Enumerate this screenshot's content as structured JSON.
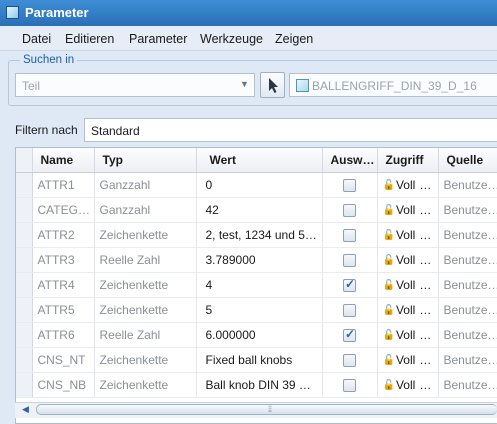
{
  "window": {
    "title": "Parameter",
    "icon": "window-icon"
  },
  "menu": [
    "Datei",
    "Editieren",
    "Parameter",
    "Werkzeuge",
    "Zeigen"
  ],
  "search": {
    "legend": "Suchen in",
    "scope_value": "Teil",
    "pick_icon": "cursor-arrow-icon",
    "object_value": "BALLENGRIFF_DIN_39_D_16",
    "object_icon": "part-icon"
  },
  "filter": {
    "label": "Filtern nach",
    "value": "Standard"
  },
  "table": {
    "columns": [
      "Name",
      "Typ",
      "Wert",
      "Ausw…",
      "Zugriff",
      "Quelle"
    ],
    "rows": [
      {
        "name": "ATTR1",
        "typ": "Ganzzahl",
        "wert": "0",
        "checked": false,
        "zugriff": "Voll",
        "quelle": "Benutze…"
      },
      {
        "name": "CATEG…",
        "typ": "Ganzzahl",
        "wert": "42",
        "checked": false,
        "zugriff": "Voll",
        "quelle": "Benutze…"
      },
      {
        "name": "ATTR2",
        "typ": "Zeichenkette",
        "wert": "2, test, 1234 und 5…",
        "checked": false,
        "zugriff": "Voll",
        "quelle": "Benutze…"
      },
      {
        "name": "ATTR3",
        "typ": "Reelle Zahl",
        "wert": "3.789000",
        "checked": false,
        "zugriff": "Voll",
        "quelle": "Benutze…"
      },
      {
        "name": "ATTR4",
        "typ": "Zeichenkette",
        "wert": "4",
        "checked": true,
        "zugriff": "Voll",
        "quelle": "Benutze…"
      },
      {
        "name": "ATTR5",
        "typ": "Zeichenkette",
        "wert": "5",
        "checked": false,
        "zugriff": "Voll",
        "quelle": "Benutze…"
      },
      {
        "name": "ATTR6",
        "typ": "Reelle Zahl",
        "wert": "6.000000",
        "checked": true,
        "zugriff": "Voll",
        "quelle": "Benutze…"
      },
      {
        "name": "CNS_NT",
        "typ": "Zeichenkette",
        "wert": "Fixed ball knobs",
        "checked": false,
        "zugriff": "Voll",
        "quelle": "Benutze…"
      },
      {
        "name": "CNS_NB",
        "typ": "Zeichenkette",
        "wert": "Ball knob DIN 39 …",
        "checked": false,
        "zugriff": "Voll",
        "quelle": "Benutze…"
      }
    ],
    "more_indicator": "…"
  },
  "scrollbar": {
    "grip": "⦙⦙⦙"
  },
  "colors": {
    "titlebar": "#2a6fb6",
    "accent": "#1c5fa8",
    "background": "#dfe9f5"
  }
}
